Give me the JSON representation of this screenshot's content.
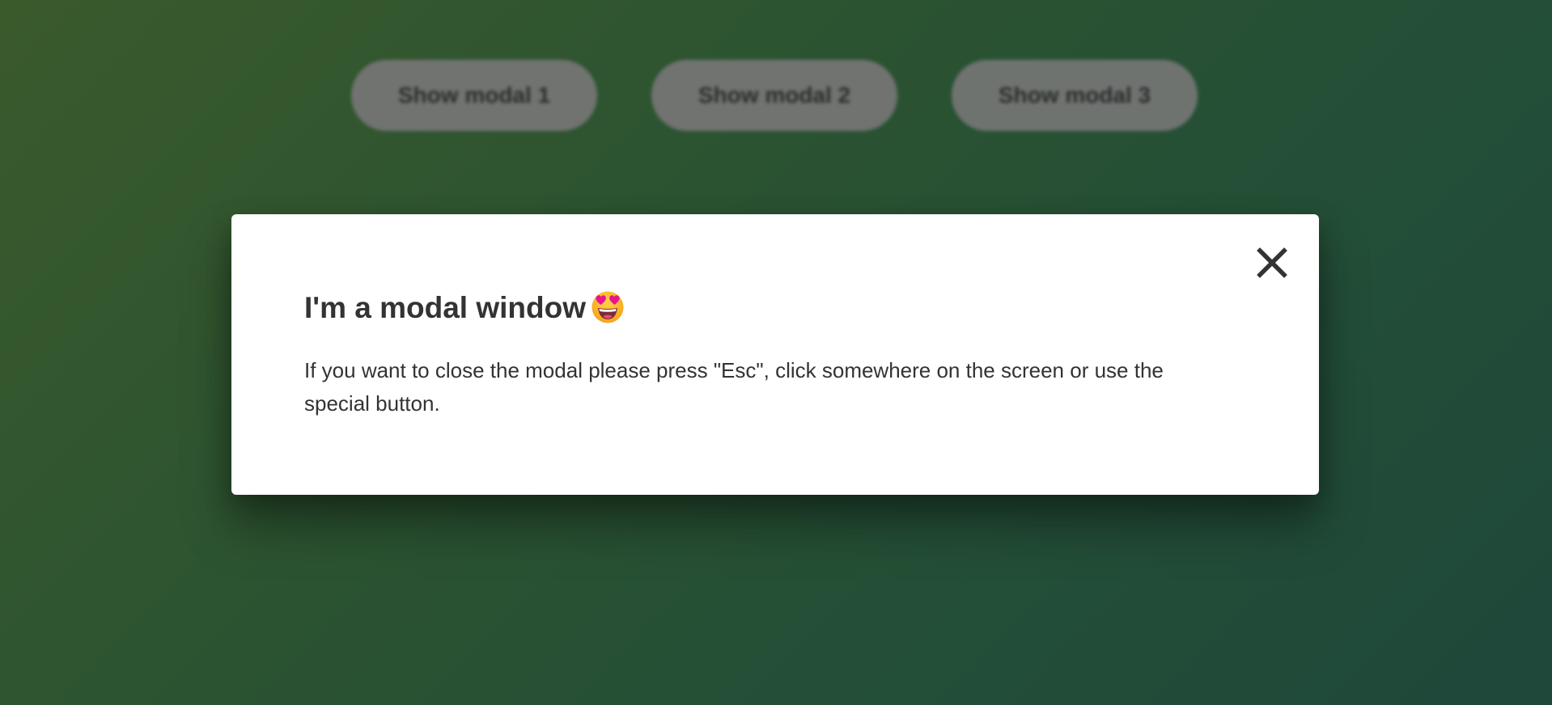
{
  "background": {
    "buttons": [
      {
        "label": "Show modal 1"
      },
      {
        "label": "Show modal 2"
      },
      {
        "label": "Show modal 3"
      }
    ]
  },
  "modal": {
    "title": "I'm a modal window",
    "title_icon": "heart-eyes-emoji-icon",
    "text": "If you want to close the modal please press \"Esc\", click somewhere on the screen or use the special button.",
    "close_icon": "close-icon"
  },
  "colors": {
    "background_start": "#3a5a2c",
    "background_end": "#1f473a",
    "modal_bg": "#ffffff",
    "text": "#333333",
    "button_bg": "#767676"
  }
}
